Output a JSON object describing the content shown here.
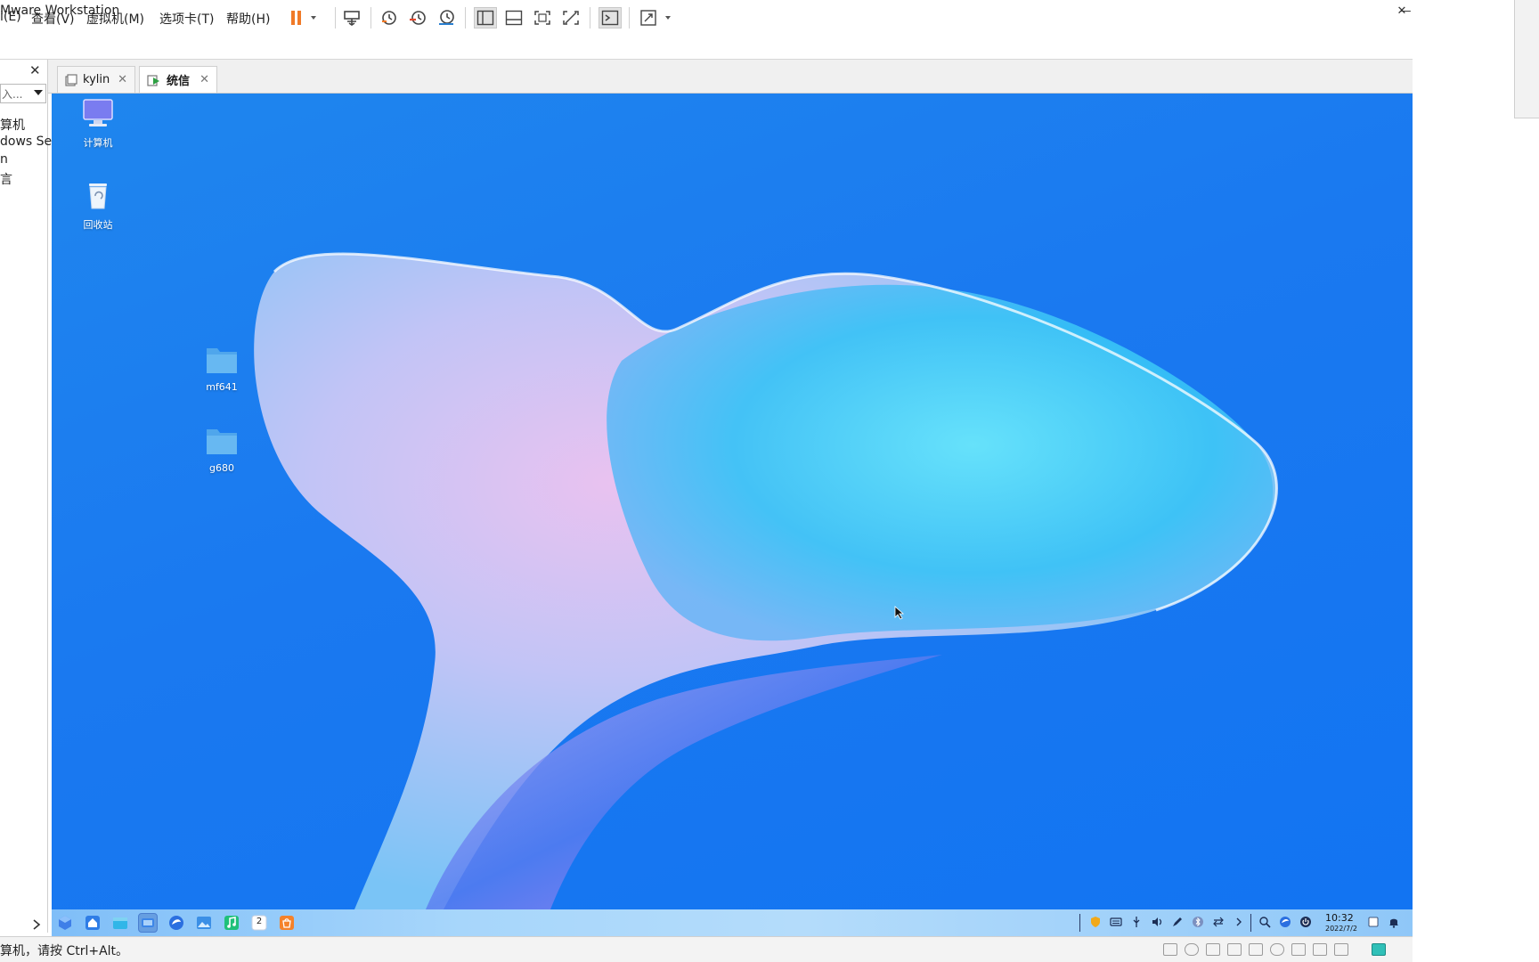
{
  "window": {
    "title": "Mware Workstation",
    "minimize": "—",
    "restore": "❐",
    "close": "✕"
  },
  "menu": {
    "items": [
      "i(E)",
      "查看(V)",
      "虚拟机(M)",
      "选项卡(T)",
      "帮助(H)"
    ]
  },
  "toolbar": {
    "icons": [
      "pause-icon",
      "send-ctrl-alt-del-icon",
      "snapshot-icon",
      "revert-snapshot-icon",
      "snapshot-manager-icon",
      "library-view-icon",
      "thumbnail-bar-icon",
      "full-screen-icon",
      "unity-icon",
      "console-icon",
      "stretch-guest-icon"
    ]
  },
  "library": {
    "close": "✕",
    "search_placeholder": "入...",
    "items": [
      "算机",
      "dows Se",
      "n",
      "言"
    ]
  },
  "tabs": [
    {
      "label": "kylin",
      "active": false,
      "close": "✕"
    },
    {
      "label": "统信",
      "active": true,
      "close": "✕"
    }
  ],
  "desktop": {
    "icons": [
      {
        "label": "计算机",
        "icon": "computer-icon"
      },
      {
        "label": "回收站",
        "icon": "trash-icon"
      },
      {
        "label": "mf641",
        "icon": "folder-icon"
      },
      {
        "label": "g680",
        "icon": "folder-icon"
      }
    ]
  },
  "taskbar": {
    "icons": [
      "launcher-icon",
      "home-icon",
      "file-manager-icon",
      "desktop-switch-icon",
      "browser-icon",
      "image-viewer-icon",
      "music-icon",
      "calendar-icon",
      "app-store-icon"
    ],
    "calendar_day": "2",
    "tray": [
      "shield-icon",
      "keyboard-icon",
      "usb-icon",
      "volume-icon",
      "pen-icon",
      "bluetooth-icon",
      "network-transfer-icon",
      "expand-icon",
      "search-icon",
      "browser-tray-icon",
      "power-icon"
    ],
    "time": "10:32",
    "date": "2022/7/2"
  },
  "statusbar": {
    "text": "算机，请按 Ctrl+Alt。"
  },
  "colors": {
    "desktop_blue": "#1a7af0",
    "pause_orange": "#f07a28",
    "folder_blue": "#4fa6ec"
  }
}
